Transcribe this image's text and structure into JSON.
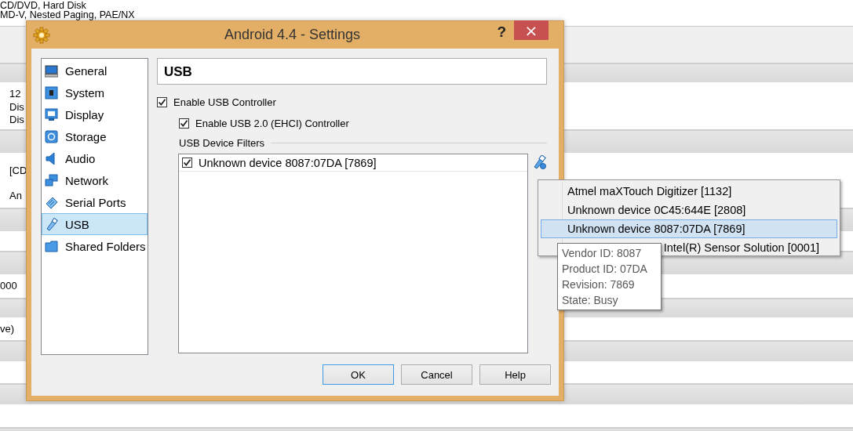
{
  "background_sections": [
    {
      "lines": [
        "CD/DVD, Hard Disk",
        "MD-V, Nested Paging, PAE/NX"
      ]
    },
    {
      "lines": [
        "12",
        "Dis",
        "Dis"
      ]
    },
    {
      "lines": [
        "[CD",
        "An"
      ]
    },
    {
      "lines": [
        "000"
      ]
    },
    {
      "lines": [
        "ve)"
      ]
    }
  ],
  "window": {
    "title": "Android 4.4 - Settings",
    "help": "?",
    "close": "×"
  },
  "sidebar": {
    "items": [
      {
        "label": "General",
        "selected": false
      },
      {
        "label": "System",
        "selected": false
      },
      {
        "label": "Display",
        "selected": false
      },
      {
        "label": "Storage",
        "selected": false
      },
      {
        "label": "Audio",
        "selected": false
      },
      {
        "label": "Network",
        "selected": false
      },
      {
        "label": "Serial Ports",
        "selected": false
      },
      {
        "label": "USB",
        "selected": true
      },
      {
        "label": "Shared Folders",
        "selected": false
      }
    ]
  },
  "page_title": "USB",
  "options": [
    {
      "label": "Enable USB Controller",
      "checked": true
    },
    {
      "label": "Enable USB 2.0 (EHCI) Controller",
      "checked": true
    }
  ],
  "filters": {
    "heading": "USB Device Filters",
    "items": [
      {
        "label": "Unknown device 8087:07DA [7869]",
        "checked": true
      }
    ]
  },
  "device_menu": {
    "items": [
      {
        "label": "Atmel maXTouch Digitizer [1132]",
        "selected": false,
        "kind": "full"
      },
      {
        "label": "Unknown device 0C45:644E [2808]",
        "selected": false,
        "kind": "full"
      },
      {
        "label": "Unknown device 8087:07DA [7869]",
        "selected": true,
        "kind": "full"
      },
      {
        "label": "Intel(R) Sensor Solution [0001]",
        "selected": false,
        "kind": "partial"
      }
    ]
  },
  "tooltip": {
    "lines": [
      "Vendor ID: 8087",
      "Product ID: 07DA",
      "Revision: 7869",
      "State: Busy"
    ]
  },
  "buttons": [
    {
      "label": "OK",
      "focused": true
    },
    {
      "label": "Cancel",
      "focused": false
    },
    {
      "label": "Help",
      "focused": false
    }
  ]
}
